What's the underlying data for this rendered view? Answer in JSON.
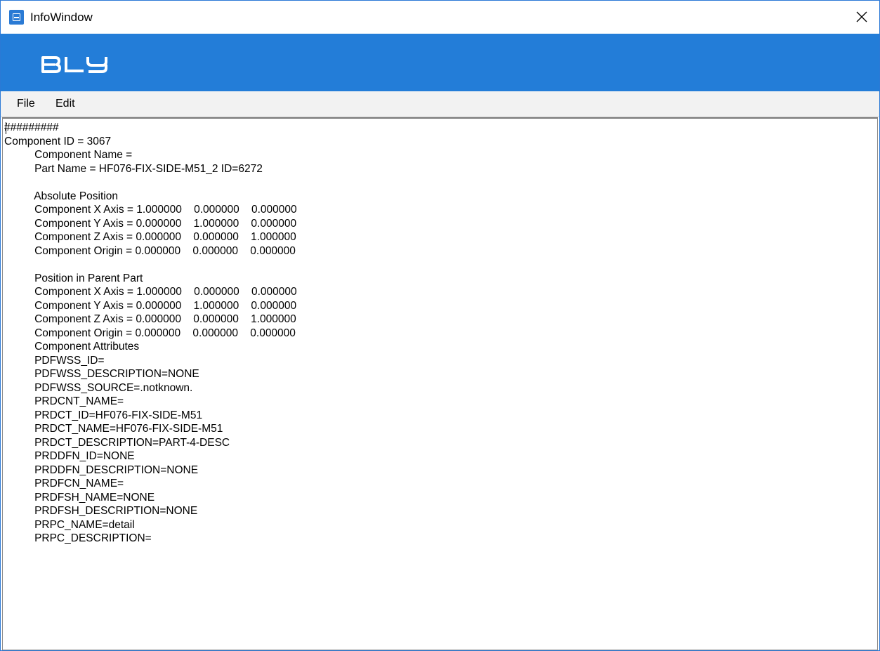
{
  "window": {
    "title": "InfoWindow",
    "app_icon": "window-app-icon",
    "close_icon": "close-x-icon"
  },
  "banner": {
    "logo_text": "BLY",
    "background_color": "#237dd8"
  },
  "menu": {
    "items": [
      {
        "label": "File"
      },
      {
        "label": "Edit"
      }
    ]
  },
  "info": {
    "text": "#########\nComponent ID = 3067\n\t  Component Name = \n\t  Part Name = HF076-FIX-SIDE-M51_2 ID=6272\n\n\t  Absolute Position\n\t  Component X Axis = 1.000000    0.000000    0.000000\n\t  Component Y Axis = 0.000000    1.000000    0.000000\n\t  Component Z Axis = 0.000000    0.000000    1.000000\n\t  Component Origin = 0.000000    0.000000    0.000000\n\n\t  Position in Parent Part\n\t  Component X Axis = 1.000000    0.000000    0.000000\n\t  Component Y Axis = 0.000000    1.000000    0.000000\n\t  Component Z Axis = 0.000000    0.000000    1.000000\n\t  Component Origin = 0.000000    0.000000    0.000000\n\t  Component Attributes\n\t  PDFWSS_ID=\n\t  PDFWSS_DESCRIPTION=NONE\n\t  PDFWSS_SOURCE=.notknown.\n\t  PRDCNT_NAME=\n\t  PRDCT_ID=HF076-FIX-SIDE-M51\n\t  PRDCT_NAME=HF076-FIX-SIDE-M51\n\t  PRDCT_DESCRIPTION=PART-4-DESC\n\t  PRDDFN_ID=NONE\n\t  PRDDFN_DESCRIPTION=NONE\n\t  PRDFCN_NAME=\n\t  PRDFSH_NAME=NONE\n\t  PRDFSH_DESCRIPTION=NONE\n\t  PRPC_NAME=detail\n\t  PRPC_DESCRIPTION="
  }
}
